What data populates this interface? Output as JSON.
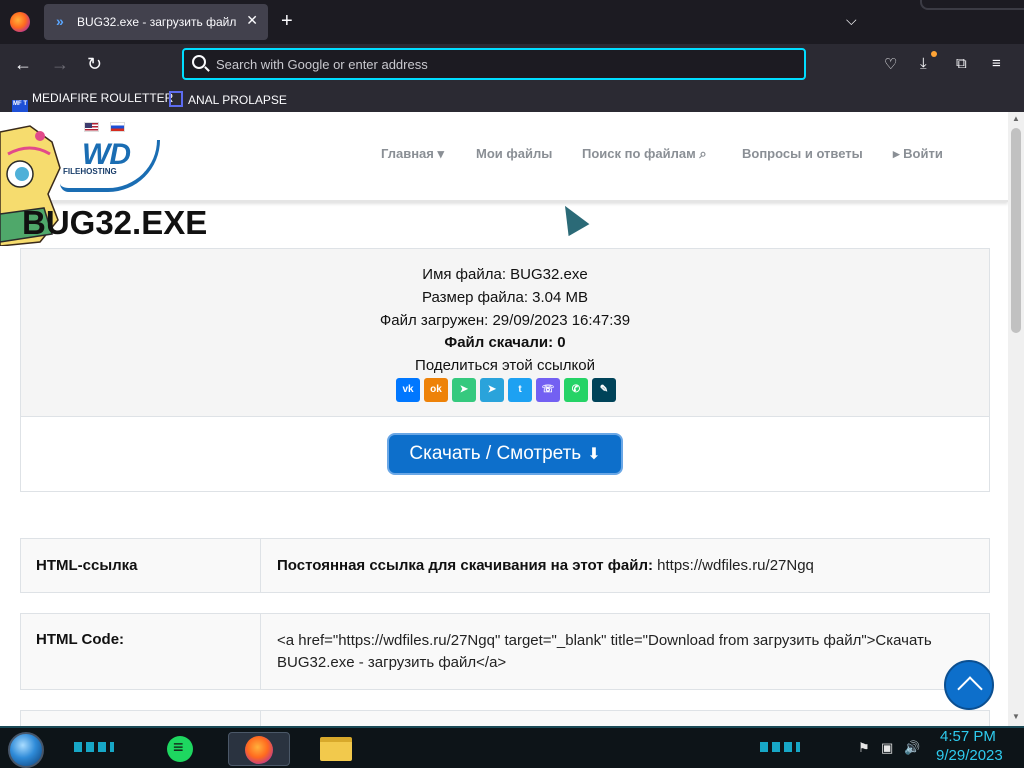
{
  "browser": {
    "tab_title": "BUG32.exe - загрузить файл",
    "tab_close": "✕",
    "new_tab": "+",
    "tab_list": "⌵",
    "url_placeholder": "Search with Google or enter address",
    "back": "←",
    "forward": "→",
    "reload": "↻",
    "pocket_icon": "♡",
    "downloads_icon": "⤓",
    "extensions_icon": "⧉",
    "menu_icon": "≡",
    "bookmarks": [
      {
        "label": "MEDIAFIRE ROULETTER",
        "icon_text": "MF T"
      },
      {
        "label": "ANAL PROLAPSE"
      }
    ]
  },
  "site": {
    "logo_text": "WD",
    "logo_sub": "FILEHOSTING",
    "menu": [
      {
        "label": "Главная ▾"
      },
      {
        "label": "Мои файлы"
      },
      {
        "label": "Поиск по файлам ⌕"
      },
      {
        "label": "Вопросы и ответы"
      },
      {
        "label": "▸ Войти"
      }
    ]
  },
  "file": {
    "title": "BUG32.EXE",
    "name_line": "Имя файла: BUG32.exe",
    "size_line": "Размер файла: 3.04 MB",
    "uploaded_line": "Файл загружен: 29/09/2023 16:47:39",
    "downloads_line": "Файл скачали: 0",
    "share_label": "Поделиться этой ссылкой",
    "share_icons": [
      {
        "name": "vk",
        "text": "vk",
        "color": "#0077ff"
      },
      {
        "name": "odnoklassniki",
        "text": "ok",
        "color": "#ee8208"
      },
      {
        "name": "gmail-share",
        "text": "➤",
        "color": "#35c97e"
      },
      {
        "name": "telegram",
        "text": "➤",
        "color": "#2aa3db"
      },
      {
        "name": "twitter",
        "text": "t",
        "color": "#1da1f2"
      },
      {
        "name": "viber",
        "text": "☏",
        "color": "#7360f2"
      },
      {
        "name": "whatsapp",
        "text": "✆",
        "color": "#25d366"
      },
      {
        "name": "livejournal",
        "text": "✎",
        "color": "#004359"
      }
    ],
    "download_button": "Скачать / Смотреть",
    "download_arrow": "⬇"
  },
  "links": [
    {
      "label": "HTML-ссылка",
      "strong": "Постоянная ссылка для скачивания на этот файл:",
      "value": " https://wdfiles.ru/27Ngq"
    },
    {
      "label": "HTML Code:",
      "strong": "",
      "value": "<a href=\"https://wdfiles.ru/27Ngq\" target=\"_blank\" title=\"Download from загрузить файл\">Скачать BUG32.exe - загрузить файл</a>"
    }
  ],
  "taskbar": {
    "time": "4:57 PM",
    "date": "9/29/2023",
    "tray_flag": "⚑",
    "tray_network": "▣",
    "tray_volume": "🔊"
  }
}
